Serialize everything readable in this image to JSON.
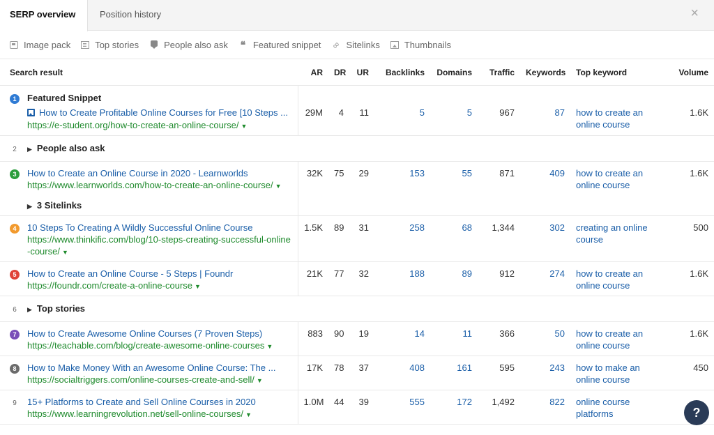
{
  "tabs": [
    {
      "label": "SERP overview"
    },
    {
      "label": "Position history"
    }
  ],
  "close_icon": "×",
  "filters": [
    {
      "label": "Image pack",
      "icon": "image-pack-icon"
    },
    {
      "label": "Top stories",
      "icon": "news-icon"
    },
    {
      "label": "People also ask",
      "icon": "question-bubble-icon"
    },
    {
      "label": "Featured snippet",
      "icon": "quote-icon"
    },
    {
      "label": "Sitelinks",
      "icon": "link-icon"
    },
    {
      "label": "Thumbnails",
      "icon": "image-icon"
    }
  ],
  "columns": {
    "result": "Search result",
    "ar": "AR",
    "dr": "DR",
    "ur": "UR",
    "backlinks": "Backlinks",
    "domains": "Domains",
    "traffic": "Traffic",
    "keywords": "Keywords",
    "top_keyword": "Top keyword",
    "volume": "Volume"
  },
  "rows": {
    "r1": {
      "pos": "1",
      "badge_color": "#2f7bd4",
      "feature_label": "Featured Snippet",
      "title": "How to Create Profitable Online Courses for Free [10 Steps ...",
      "url": "https://e-student.org/how-to-create-an-online-course/",
      "ar": "29M",
      "dr": "4",
      "ur": "11",
      "backlinks": "5",
      "domains": "5",
      "traffic": "967",
      "keywords": "87",
      "top_keyword": "how to create an online course",
      "volume": "1.6K"
    },
    "g2": {
      "pos": "2",
      "label": "People also ask"
    },
    "r3": {
      "pos": "3",
      "badge_color": "#2e9e3e",
      "title": "How to Create an Online Course in 2020 - Learnworlds",
      "url": "https://www.learnworlds.com/how-to-create-an-online-course/",
      "sitelinks": "3 Sitelinks",
      "ar": "32K",
      "dr": "75",
      "ur": "29",
      "backlinks": "153",
      "domains": "55",
      "traffic": "871",
      "keywords": "409",
      "top_keyword": "how to create an online course",
      "volume": "1.6K"
    },
    "r4": {
      "pos": "4",
      "badge_color": "#f29a2e",
      "title": "10 Steps To Creating A Wildly Successful Online Course",
      "url": "https://www.thinkific.com/blog/10-steps-creating-successful-online-course/",
      "ar": "1.5K",
      "dr": "89",
      "ur": "31",
      "backlinks": "258",
      "domains": "68",
      "traffic": "1,344",
      "keywords": "302",
      "top_keyword": "creating an online course",
      "volume": "500"
    },
    "r5": {
      "pos": "5",
      "badge_color": "#e0443a",
      "title": "How to Create an Online Course - 5 Steps | Foundr",
      "url": "https://foundr.com/create-a-online-course",
      "ar": "21K",
      "dr": "77",
      "ur": "32",
      "backlinks": "188",
      "domains": "89",
      "traffic": "912",
      "keywords": "274",
      "top_keyword": "how to create an online course",
      "volume": "1.6K"
    },
    "g6": {
      "pos": "6",
      "label": "Top stories"
    },
    "r7": {
      "pos": "7",
      "badge_color": "#7a4fb8",
      "title": "How to Create Awesome Online Courses (7 Proven Steps)",
      "url": "https://teachable.com/blog/create-awesome-online-courses",
      "ar": "883",
      "dr": "90",
      "ur": "19",
      "backlinks": "14",
      "domains": "11",
      "traffic": "366",
      "keywords": "50",
      "top_keyword": "how to create an online course",
      "volume": "1.6K"
    },
    "r8": {
      "pos": "8",
      "badge_color": "#6b6b6b",
      "title": "How to Make Money With an Awesome Online Course: The ...",
      "url": "https://socialtriggers.com/online-courses-create-and-sell/",
      "ar": "17K",
      "dr": "78",
      "ur": "37",
      "backlinks": "408",
      "domains": "161",
      "traffic": "595",
      "keywords": "243",
      "top_keyword": "how to make an online course",
      "volume": "450"
    },
    "r9": {
      "pos": "9",
      "title": "15+ Platforms to Create and Sell Online Courses in 2020",
      "url": "https://www.learningrevolution.net/sell-online-courses/",
      "ar": "1.0M",
      "dr": "44",
      "ur": "39",
      "backlinks": "555",
      "domains": "172",
      "traffic": "1,492",
      "keywords": "822",
      "top_keyword": "online course platforms",
      "volume": ""
    }
  },
  "help_label": "?"
}
